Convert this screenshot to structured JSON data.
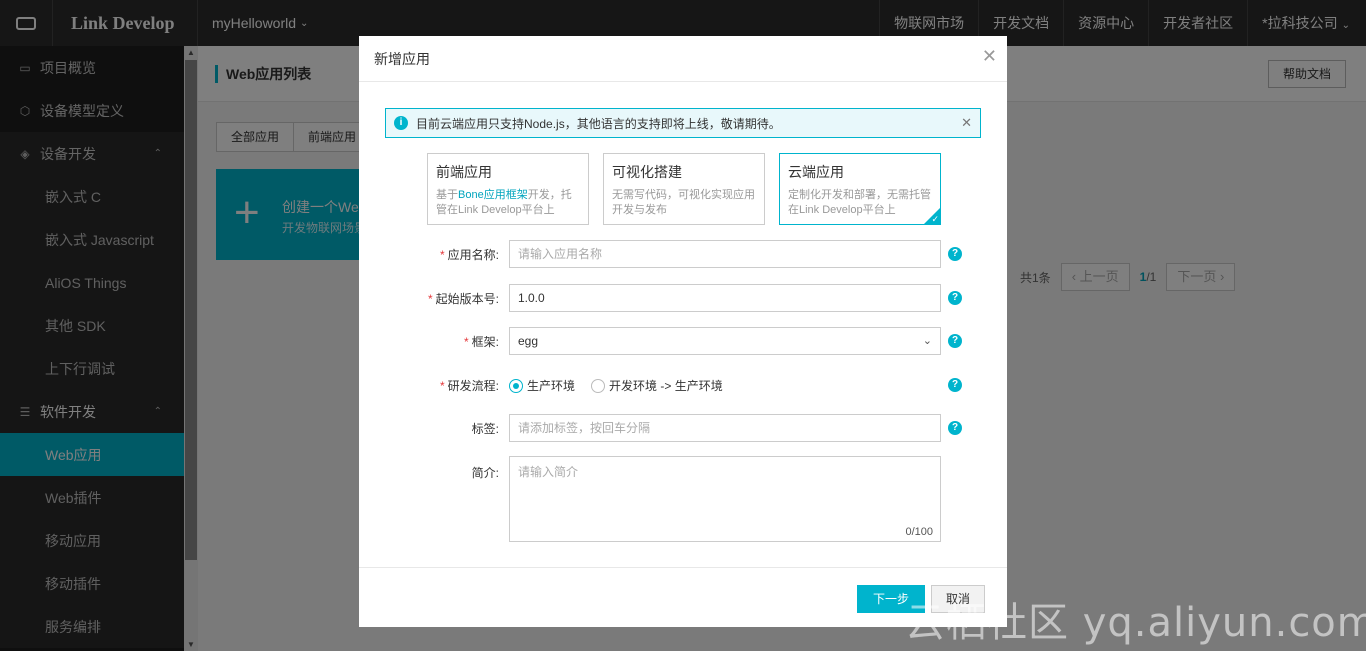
{
  "topbar": {
    "brand": "Link Develop",
    "project": "myHelloworld",
    "nav": [
      "物联网市场",
      "开发文档",
      "资源中心",
      "开发者社区"
    ],
    "company": "*拉科技公司"
  },
  "sidebar": {
    "items": [
      {
        "label": "项目概览",
        "icon": "folder-icon"
      },
      {
        "label": "设备模型定义",
        "icon": "cube-icon"
      },
      {
        "label": "设备开发",
        "icon": "layers-icon"
      }
    ],
    "device_dev_sub": [
      "嵌入式 C",
      "嵌入式 Javascript",
      "AliOS Things",
      "其他 SDK",
      "上下行调试"
    ],
    "software_dev": {
      "label": "软件开发",
      "icon": "list-icon"
    },
    "software_sub": [
      "Web应用",
      "Web插件",
      "移动应用",
      "移动插件",
      "服务编排"
    ],
    "active": "Web应用"
  },
  "main": {
    "title": "Web应用列表",
    "help": "帮助文档",
    "tabs": [
      "全部应用",
      "前端应用"
    ],
    "create_title": "创建一个Web",
    "create_desc": "开发物联网场景",
    "pager": {
      "total": "共1条",
      "prev": "上一页",
      "page": "1",
      "pages": "/1",
      "next": "下一页"
    }
  },
  "modal": {
    "title": "新增应用",
    "notice": "目前云端应用只支持Node.js，其他语言的支持即将上线，敬请期待。",
    "types": [
      {
        "title": "前端应用",
        "desc_pre": "基于",
        "desc_link": "Bone应用框架",
        "desc_post": "开发，托管在Link Develop平台上"
      },
      {
        "title": "可视化搭建",
        "desc": "无需写代码，可视化实现应用开发与发布"
      },
      {
        "title": "云端应用",
        "desc": "定制化开发和部署，无需托管在Link Develop平台上"
      }
    ],
    "form": {
      "name_label": "应用名称:",
      "name_placeholder": "请输入应用名称",
      "version_label": "起始版本号:",
      "version_value": "1.0.0",
      "framework_label": "框架:",
      "framework_value": "egg",
      "flow_label": "研发流程:",
      "flow_options": [
        "生产环境",
        "开发环境 -> 生产环境"
      ],
      "tags_label": "标签:",
      "tags_placeholder": "请添加标签，按回车分隔",
      "intro_label": "简介:",
      "intro_placeholder": "请输入简介",
      "intro_count": "0/100"
    },
    "next": "下一步",
    "cancel": "取消"
  },
  "watermark": "云栖社区 yq.aliyun.com",
  "colors": {
    "accent": "#00b4cd",
    "topbar": "#2d2d2d",
    "sidebar": "#1f1f1f"
  }
}
